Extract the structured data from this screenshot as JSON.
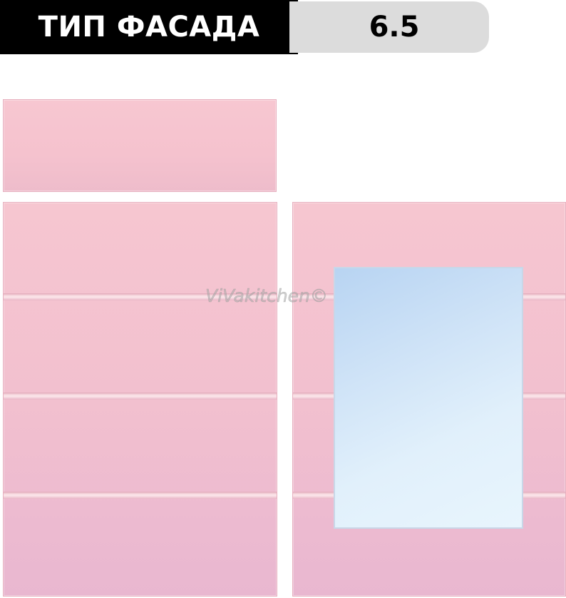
{
  "header": {
    "label": "ТИП ФАСАДА",
    "value": "6.5"
  },
  "watermark": "ViVakitchen©",
  "colors": {
    "header_bg": "#000000",
    "value_bg": "#dcdcdc",
    "facade_pink": "#f3c2cf",
    "mirror_blue": "#cfe3f7"
  }
}
